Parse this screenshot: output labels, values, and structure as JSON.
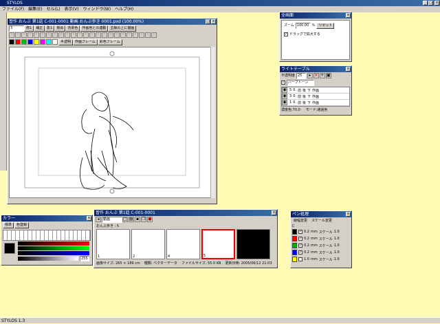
{
  "app": {
    "title": "STYLOS",
    "status": "STYLOS 1.3"
  },
  "menu": [
    "ファイル(F)",
    "編集(E)",
    "セル(L)",
    "表示(V)",
    "ウィンドウ(W)",
    "ヘルプ(H)"
  ],
  "canvas_window": {
    "title": "習作 おんぶ 第1話 C-001-0001 動画 おんぶ歩き 0001.pxd (100.00%)",
    "layer_field": "3",
    "toolbar1": [
      "修1",
      "補正",
      "影1",
      "検出",
      "背景色",
      "作画色との連動",
      "主線の上に描画"
    ],
    "toolbar2": [
      "半透明",
      "作画フレーム",
      "彩色フレーム"
    ]
  },
  "zoom_panel": {
    "title": "全画面",
    "zoom_label": "ズーム",
    "zoom_value": "100.00",
    "zoom_unit": "%",
    "reset": "リセット",
    "drag_option": "ドラッグで拡大する"
  },
  "light_table": {
    "title": "ライトテーブル",
    "opacity_label": "不透明度",
    "opacity_value": "25",
    "mode": "ハーフトーン",
    "rows": [
      {
        "num": "5",
        "f": "0.",
        "a": "前",
        "b": "後",
        "c": "下",
        "combo": "作画"
      },
      {
        "num": "3",
        "f": "0.",
        "a": "前",
        "b": "後",
        "c": "下",
        "combo": "作画"
      },
      {
        "num": "1",
        "f": "0.",
        "a": "前",
        "b": "後",
        "c": "下",
        "combo": "作画"
      }
    ],
    "footer1": "濃度色:70.0",
    "footer2": "モード:通過色"
  },
  "color_panel": {
    "title": "カラー",
    "tabs": [
      "標準",
      "色登録"
    ],
    "slider_values": [
      "",
      "",
      "",
      ""
    ],
    "alpha": "255"
  },
  "timeline": {
    "title": "習作 おんぶ 第1話 C-001-0001",
    "dropdown": "動画",
    "track": "おんぶ歩き : 5",
    "frames": [
      "1",
      "2",
      "4",
      "5",
      ""
    ],
    "status": [
      "画像サイズ: 265 × 189 cm",
      "種類: ベクターデータ",
      "ファイルサイズ: 55.0 KB",
      "更新日時: 2005/06/12 21:03"
    ]
  },
  "pen_panel": {
    "title": "ペン処理",
    "tabs": [
      "線幅変更",
      "スケール変更"
    ],
    "head": "C",
    "rows": [
      {
        "color": "#000000",
        "size": "0.2",
        "unit": "mm",
        "label": "スケール",
        "val": "1.0"
      },
      {
        "color": "#ff0000",
        "size": "0.2",
        "unit": "mm",
        "label": "スケール",
        "val": "1.0"
      },
      {
        "color": "#00b000",
        "size": "0.2",
        "unit": "mm",
        "label": "スケール",
        "val": "1.0"
      },
      {
        "color": "#0000ff",
        "size": "0.2",
        "unit": "mm",
        "label": "スケール",
        "val": "1.0"
      },
      {
        "color": "#ffff00",
        "size": "1.0",
        "unit": "mm",
        "label": "スケール",
        "val": "1.0"
      }
    ]
  },
  "colors": {
    "palette": [
      "#000000",
      "#ff0000",
      "#00c000",
      "#0000ff",
      "#ffff00",
      "#ff00ff",
      "#00ffff",
      "#ffffff"
    ]
  }
}
